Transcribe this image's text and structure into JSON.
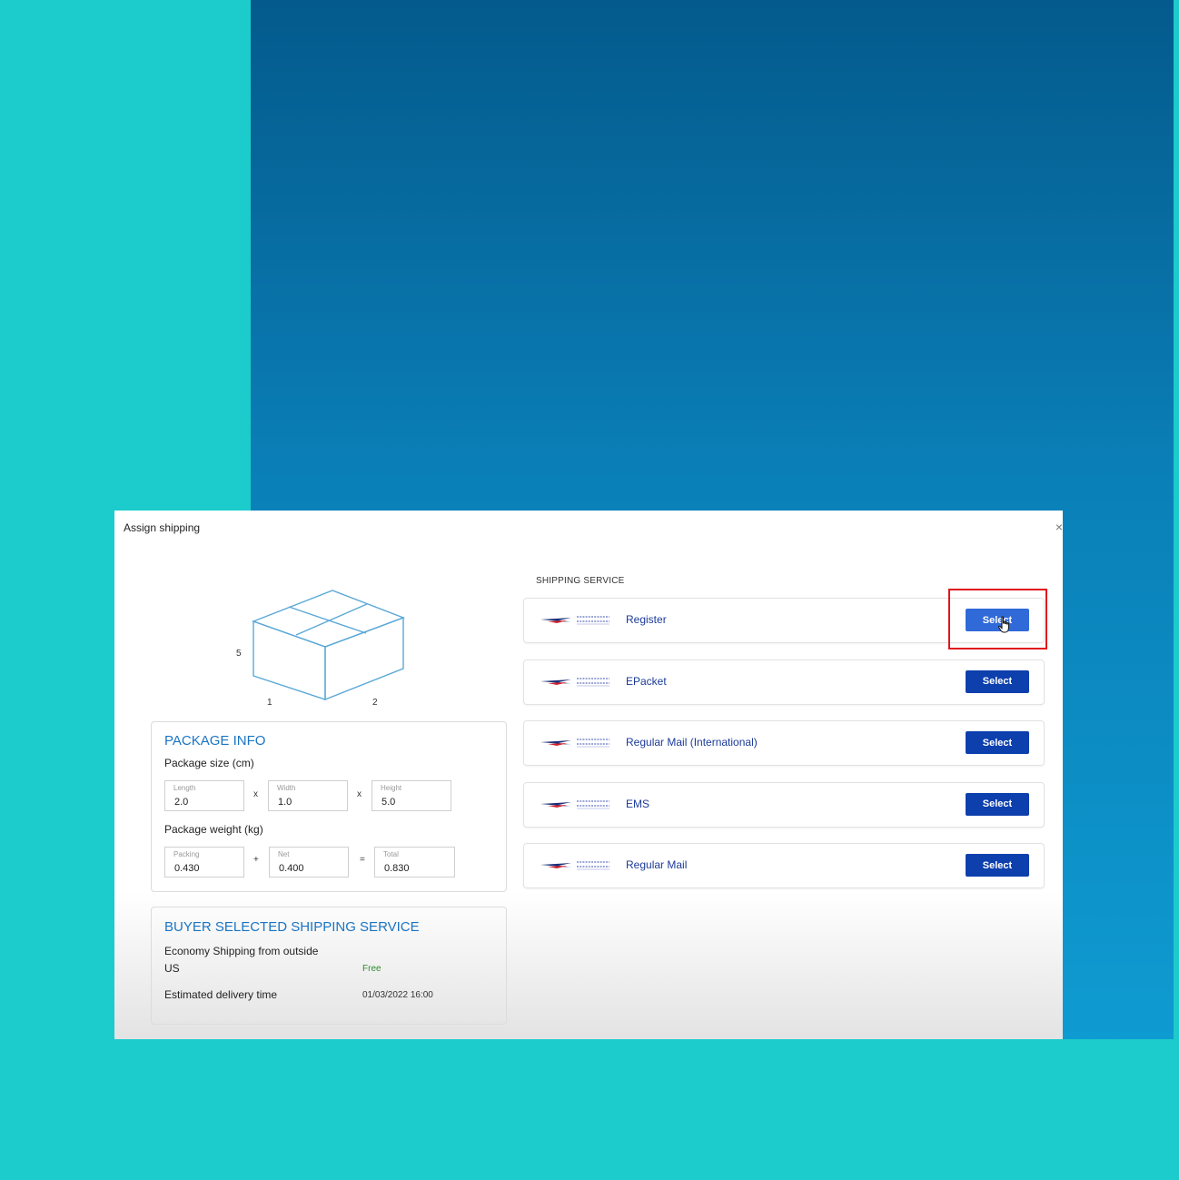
{
  "dialog": {
    "title": "Assign shipping",
    "close_glyph": "×"
  },
  "box_dimensions": {
    "height": "5",
    "length": "1",
    "width": "2"
  },
  "package_info": {
    "heading": "PACKAGE INFO",
    "size_label": "Package size (cm)",
    "length_caption": "Length",
    "length_value": "2.0",
    "width_caption": "Width",
    "width_value": "1.0",
    "height_caption": "Height",
    "height_value": "5.0",
    "weight_label": "Package weight (kg)",
    "packing_caption": "Packing",
    "packing_value": "0.430",
    "net_caption": "Net",
    "net_value": "0.400",
    "total_caption": "Total",
    "total_value": "0.830",
    "op_times": "x",
    "op_plus": "+",
    "op_equals": "="
  },
  "buyer_service": {
    "heading": "BUYER SELECTED SHIPPING SERVICE",
    "service_line1": "Economy Shipping from outside",
    "service_line2": "US",
    "price": "Free",
    "delivery_label": "Estimated delivery time",
    "delivery_value": "01/03/2022 16:00"
  },
  "shipping_service": {
    "section_label": "SHIPPING SERVICE",
    "button_label": "Select",
    "services": [
      {
        "name": "Register"
      },
      {
        "name": "EPacket"
      },
      {
        "name": "Regular Mail (International)"
      },
      {
        "name": "EMS"
      },
      {
        "name": "Regular Mail"
      }
    ]
  },
  "colors": {
    "background": "#1ccbcb",
    "panel_blue": "#0a7fb7",
    "heading_blue": "#1b74c3",
    "button_blue": "#0d3fad",
    "highlight_red": "#e0141e"
  },
  "icons": {
    "box": "package-box-icon",
    "carrier_logo": "thailand-post-logo",
    "cursor": "hand-pointer-icon"
  }
}
